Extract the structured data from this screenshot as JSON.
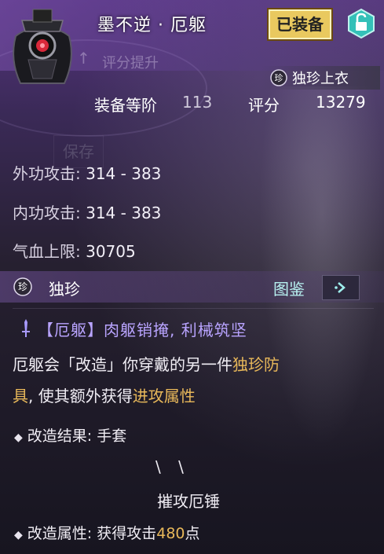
{
  "header": {
    "item_name": "墨不逆 · 厄躯",
    "equipped_badge": "已装备",
    "score_up_label": "评分提升",
    "quality_label": "独珍上衣",
    "level_label": "装备等阶",
    "level_value": "113",
    "score_label": "评分",
    "score_value": "13279",
    "save_ghost": "保存"
  },
  "stats": [
    {
      "label": "外功攻击:",
      "value": "314 - 383"
    },
    {
      "label": "内功攻击:",
      "value": "314 - 383"
    },
    {
      "label": "气血上限:",
      "value": "30705"
    }
  ],
  "section": {
    "title": "独珍",
    "codex_label": "图鉴"
  },
  "effect": {
    "title": "【厄躯】肉躯销掩, 利械筑坚",
    "desc_1": "厄躯会「改造」你穿戴的另一件",
    "desc_1_gold": "独珍防",
    "desc_2_gold_start": "具",
    "desc_2": ", 使其额外获得",
    "desc_2_gold": "进攻属性",
    "result_label": "改造结果:",
    "result_value": "手套",
    "arrows": "\\ \\",
    "result_item": "摧攻厄锤",
    "attr_label": "改造属性:",
    "attr_prefix": "获得攻击",
    "attr_value": "480",
    "attr_suffix": "点"
  },
  "colors": {
    "gold_text": "#e8b85a",
    "effect_title": "#b9a4ff",
    "badge_bg": "#e9c95f",
    "codex_text": "#b7f1f0"
  },
  "icons": [
    "helmet-avatar-icon",
    "lock-open-icon",
    "treasure-quality-icon",
    "sword-icon",
    "chevron-right-icon"
  ]
}
